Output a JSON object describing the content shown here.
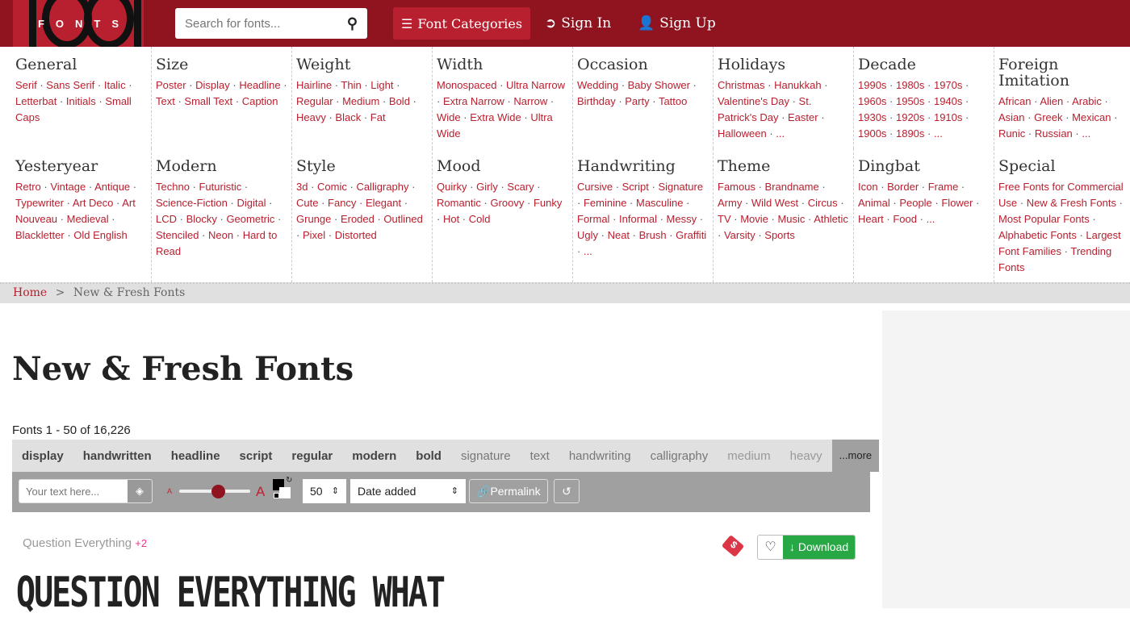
{
  "header": {
    "logo_text": "FONTS",
    "search_placeholder": "Search for fonts...",
    "font_categories": "Font Categories",
    "sign_in": "Sign In",
    "sign_up": "Sign Up"
  },
  "categories": [
    {
      "title": "General",
      "links": [
        "Serif",
        "Sans Serif",
        "Italic",
        "Letterbat",
        "Initials",
        "Small Caps"
      ]
    },
    {
      "title": "Size",
      "links": [
        "Poster",
        "Display",
        "Headline",
        "Text",
        "Small Text",
        "Caption"
      ]
    },
    {
      "title": "Weight",
      "links": [
        "Hairline",
        "Thin",
        "Light",
        "Regular",
        "Medium",
        "Bold",
        "Heavy",
        "Black",
        "Fat"
      ]
    },
    {
      "title": "Width",
      "links": [
        "Monospaced",
        "Ultra Narrow",
        "Extra Narrow",
        "Narrow",
        "Wide",
        "Extra Wide",
        "Ultra Wide"
      ]
    },
    {
      "title": "Occasion",
      "links": [
        "Wedding",
        "Baby Shower",
        "Birthday",
        "Party",
        "Tattoo"
      ]
    },
    {
      "title": "Holidays",
      "links": [
        "Christmas",
        "Hanukkah",
        "Valentine's Day",
        "St. Patrick's Day",
        "Easter",
        "Halloween",
        "..."
      ]
    },
    {
      "title": "Decade",
      "links": [
        "1990s",
        "1980s",
        "1970s",
        "1960s",
        "1950s",
        "1940s",
        "1930s",
        "1920s",
        "1910s",
        "1900s",
        "1890s",
        "..."
      ]
    },
    {
      "title": "Foreign Imitation",
      "links": [
        "African",
        "Alien",
        "Arabic",
        "Asian",
        "Greek",
        "Mexican",
        "Runic",
        "Russian",
        "..."
      ]
    },
    {
      "title": "Yesteryear",
      "links": [
        "Retro",
        "Vintage",
        "Antique",
        "Typewriter",
        "Art Deco",
        "Art Nouveau",
        "Medieval",
        "Blackletter",
        "Old English"
      ]
    },
    {
      "title": "Modern",
      "links": [
        "Techno",
        "Futuristic",
        "Science-Fiction",
        "Digital",
        "LCD",
        "Blocky",
        "Geometric",
        "Stenciled",
        "Neon",
        "Hard to Read"
      ]
    },
    {
      "title": "Style",
      "links": [
        "3d",
        "Comic",
        "Calligraphy",
        "Cute",
        "Fancy",
        "Elegant",
        "Grunge",
        "Eroded",
        "Outlined",
        "Pixel",
        "Distorted"
      ]
    },
    {
      "title": "Mood",
      "links": [
        "Quirky",
        "Girly",
        "Scary",
        "Romantic",
        "Groovy",
        "Funky",
        "Hot",
        "Cold"
      ]
    },
    {
      "title": "Handwriting",
      "links": [
        "Cursive",
        "Script",
        "Signature",
        "Feminine",
        "Masculine",
        "Formal",
        "Informal",
        "Messy",
        "Ugly",
        "Neat",
        "Brush",
        "Graffiti",
        "..."
      ]
    },
    {
      "title": "Theme",
      "links": [
        "Famous",
        "Brandname",
        "Army",
        "Wild West",
        "Circus",
        "TV",
        "Movie",
        "Music",
        "Athletic",
        "Varsity",
        "Sports"
      ]
    },
    {
      "title": "Dingbat",
      "links": [
        "Icon",
        "Border",
        "Frame",
        "Animal",
        "People",
        "Flower",
        "Heart",
        "Food",
        "..."
      ]
    },
    {
      "title": "Special",
      "links": [
        "Free Fonts for Commercial Use",
        "New & Fresh Fonts",
        "Most Popular Fonts",
        "Alphabetic Fonts",
        "Largest Font Families",
        "Trending Fonts"
      ]
    }
  ],
  "breadcrumb": {
    "home": "Home",
    "sep": ">",
    "current": "New & Fresh Fonts"
  },
  "page_title": "New & Fresh Fonts",
  "count": "Fonts 1 - 50 of 16,226",
  "tags": [
    {
      "t": "display",
      "s": "b"
    },
    {
      "t": "handwritten",
      "s": "b"
    },
    {
      "t": "headline",
      "s": "b"
    },
    {
      "t": "script",
      "s": "b"
    },
    {
      "t": "regular",
      "s": "b"
    },
    {
      "t": "modern",
      "s": "b"
    },
    {
      "t": "bold",
      "s": "b"
    },
    {
      "t": "signature",
      "s": "l"
    },
    {
      "t": "text",
      "s": "l"
    },
    {
      "t": "handwriting",
      "s": "l"
    },
    {
      "t": "calligraphy",
      "s": "l"
    },
    {
      "t": "medium",
      "s": "f"
    },
    {
      "t": "heavy",
      "s": "f"
    }
  ],
  "more": "...more",
  "toolbar": {
    "text_placeholder": "Your text here...",
    "small_a": "A",
    "big_a": "A",
    "size_value": "50",
    "sort": "Date added",
    "permalink": "Permalink",
    "size_percent": 55
  },
  "font": {
    "name": "Question Everything",
    "extra": "+2",
    "download": "Download",
    "preview": "QUESTION EVERYTHING WHAT"
  },
  "colors": {
    "header": "#8f141f",
    "accent": "#b8202f",
    "download": "#28a745"
  }
}
